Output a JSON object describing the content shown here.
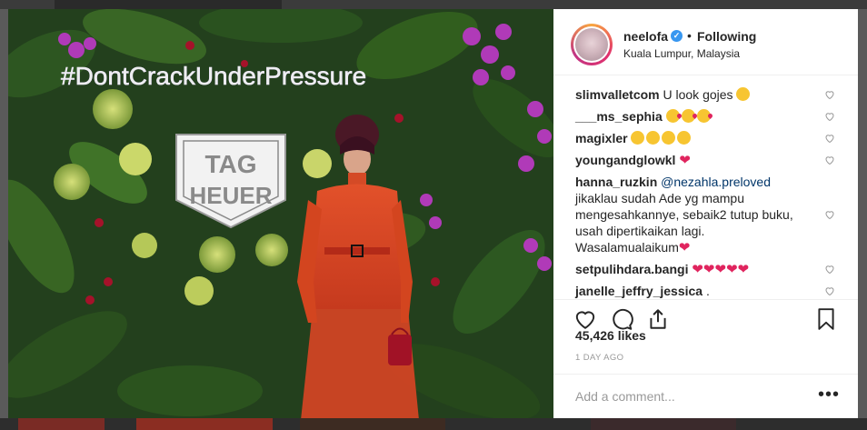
{
  "post": {
    "username": "neelofa",
    "follow_status": "Following",
    "location": "Kuala Lumpur, Malaysia",
    "photo_text": {
      "hashtag": "#DontCrackUnderPressure",
      "brand_line1": "TAG",
      "brand_line2": "HEUER"
    },
    "comments": [
      {
        "user": "slimvalletcom",
        "text": "U look gojes",
        "emoji": [
          "grin"
        ]
      },
      {
        "user": "___ms_sephia",
        "text": "",
        "emoji": [
          "kiss",
          "kiss",
          "kiss"
        ]
      },
      {
        "user": "magixler",
        "text": "",
        "emoji": [
          "hearteyes",
          "hearteyes",
          "hearteyes",
          "hearteyes"
        ]
      },
      {
        "user": "youngandglowkl",
        "text": "",
        "emoji": [
          "redheart"
        ]
      },
      {
        "user": "hanna_ruzkin",
        "mention": "@nezahla.preloved",
        "lines": [
          "jikaklau sudah Ade yg mampu",
          "mengesahkannye, sebaik2 tutup buku,",
          "usah dipertikaikan lagi.",
          "Wasalamualaikum"
        ],
        "emoji": [
          "redheart"
        ]
      },
      {
        "user": "setpulihdara.bangi",
        "text": "",
        "emoji": [
          "redheart",
          "redheart",
          "redheart",
          "redheart",
          "redheart"
        ]
      },
      {
        "user": "janelle_jeffry_jessica",
        "text": "."
      }
    ],
    "likes": "45,426 likes",
    "time": "1 DAY AGO",
    "add_comment_placeholder": "Add a comment...",
    "more_label": "•••"
  },
  "icons": [
    "verified-badge-icon",
    "heart-icon",
    "comment-icon",
    "share-icon",
    "bookmark-icon",
    "more-options-icon"
  ],
  "colors": {
    "accent": "#3897f0",
    "heart": "#e0245e",
    "text": "#262626",
    "muted": "#999999"
  }
}
